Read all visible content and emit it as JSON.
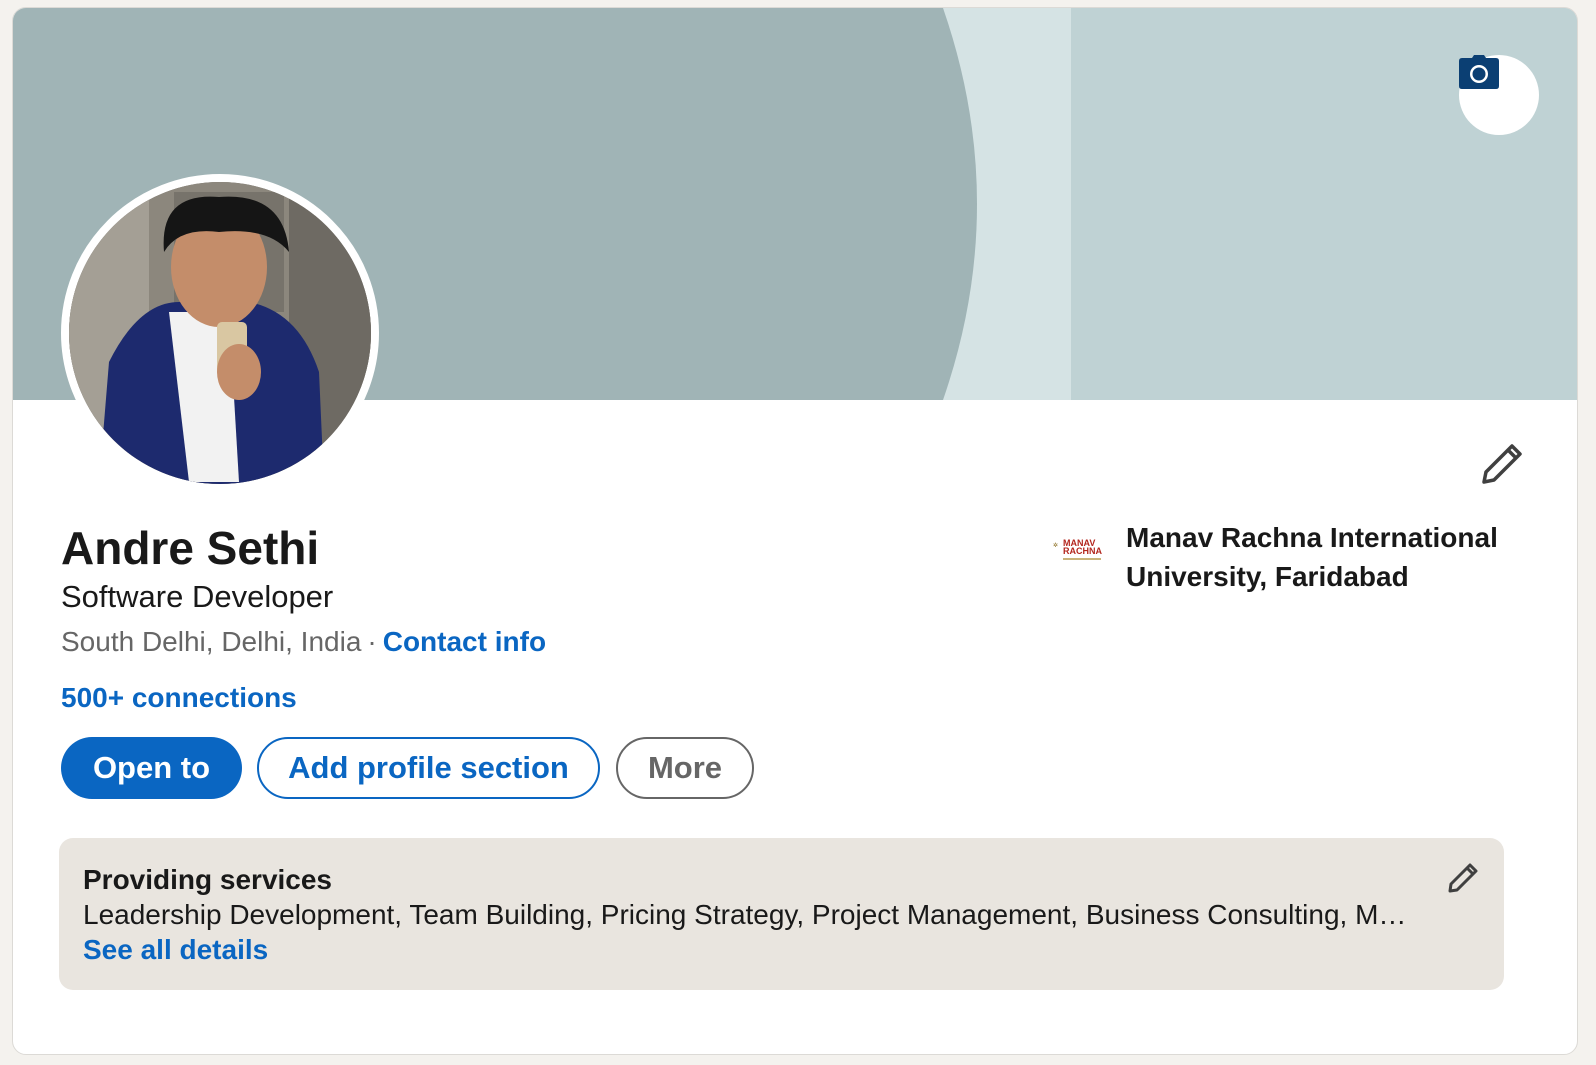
{
  "profile": {
    "name": "Andre Sethi",
    "headline": "Software Developer",
    "location": "South Delhi, Delhi, India",
    "separator": "·",
    "contact_info_label": "Contact info",
    "connections_label": "500+ connections"
  },
  "actions": {
    "open_to_label": "Open to",
    "add_section_label": "Add profile section",
    "more_label": "More"
  },
  "education": {
    "name": "Manav Rachna International University, Faridabad",
    "logo_text_line1": "MANAV",
    "logo_text_line2": "RACHNA"
  },
  "services": {
    "title": "Providing services",
    "list": "Leadership Development, Team Building, Pricing Strategy, Project Management, Business Consulting, M…",
    "see_all_label": "See all details"
  },
  "icons": {
    "banner_camera": "camera-icon",
    "edit_intro": "pencil-icon",
    "edit_services": "pencil-icon"
  },
  "colors": {
    "accent": "#0a66c2",
    "banner_dark": "#a0b4b6",
    "banner_mid": "#d5e3e4",
    "banner_light": "#bfd2d4",
    "services_bg": "#e9e5df",
    "camera_icon": "#0b3f73"
  }
}
